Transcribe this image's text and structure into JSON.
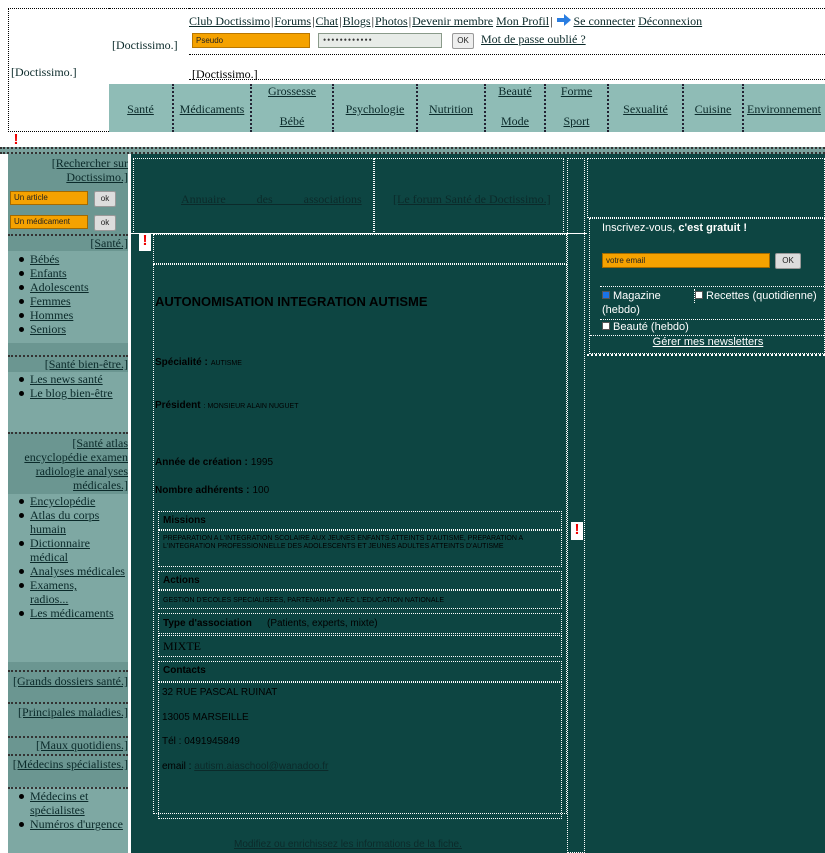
{
  "logo": {
    "main": "[Doctissimo.]",
    "secondary": "[Doctissimo.]",
    "banner": "[Doctissimo.]"
  },
  "topnav": {
    "links": [
      "Club Doctissimo",
      "Forums",
      "Chat",
      "Blogs",
      "Photos",
      "Devenir membre",
      "Mon Profil"
    ],
    "connect": "Se connecter",
    "disconnect": "Déconnexion"
  },
  "login": {
    "pseudo_value": "Pseudo",
    "password_value": "••••••••••••",
    "ok_label": "OK",
    "forgot": "Mot de passe oublié ?"
  },
  "mainnav": [
    {
      "label": "Santé"
    },
    {
      "label": "Médicaments"
    },
    {
      "top": "Grossesse",
      "bottom": "Bébé"
    },
    {
      "label": "Psychologie"
    },
    {
      "label": "Nutrition"
    },
    {
      "top": "Beauté",
      "bottom": "Mode"
    },
    {
      "top": "Forme",
      "bottom": "Sport"
    },
    {
      "label": "Sexualité"
    },
    {
      "label": "Cuisine"
    },
    {
      "label": "Environnement"
    }
  ],
  "sidebar": {
    "search_header": "[Rechercher sur Doctissimo.]",
    "search_article": "Un article",
    "search_medicament": "Un médicament",
    "ok_label": "ok",
    "sante_header": "[Santé.]",
    "sante_items": [
      "Bébés",
      "Enfants",
      "Adolescents",
      "Femmes",
      "Hommes",
      "Seniors"
    ],
    "bienetre_header": "[Santé bien-être.]",
    "bienetre_items": [
      "Les news santé",
      "Le blog bien-être"
    ],
    "atlas_header": "[Santé atlas encyclopédie examen radiologie analyses médicales.]",
    "atlas_items": [
      "Encyclopédie",
      "Atlas du corps humain",
      "Dictionnaire médical",
      "Analyses médicales",
      "Examens, radios...",
      "Les médicaments"
    ],
    "dossiers_header": "[Grands dossiers santé.]",
    "maladies_header": "[Principales maladies.]",
    "maux_header": "[Maux quotidiens.]",
    "medecins_header": "[Médecins spécialistes.]",
    "medecins_items": [
      "Médecins et spécialistes",
      "Numéros d'urgence"
    ]
  },
  "content": {
    "tab_annuaire": "Annuaire des associations",
    "tab_forum": "[Le forum Santé de Doctissimo.]",
    "title": "AUTONOMISATION INTEGRATION AUTISME",
    "specialite_label": "Spécialité :",
    "specialite_value": "AUTISME",
    "president_label": "Président",
    "president_value": ": MONSIEUR ALAIN NUGUET",
    "annee_label": "Année de création :",
    "annee_value": "1995",
    "adherents_label": "Nombre adhérents :",
    "adherents_value": "100",
    "missions_label": "Missions",
    "missions_value": "PREPARATION A L'INTEGRATION SCOLAIRE AUX JEUNES ENFANTS ATTEINTS D'AUTISME, PREPARATION A L'INTEGRATION PROFESSIONNELLE DES ADOLESCENTS ET JEUNES ADULTES ATTEINTS D'AUTISME",
    "actions_label": "Actions",
    "actions_value": "GESTION D'ECOLES SPECIALISEES, PARTENARIAT AVEC L'EDUCATION NATIONALE",
    "type_label": "Type d'association",
    "type_note": "(Patients, experts, mixte)",
    "type_value": "MIXTE",
    "contacts_label": "Contacts",
    "address1": "32 RUE PASCAL RUINAT",
    "address2": "13005 MARSEILLE",
    "tel": "Tél : 0491945849",
    "email_label": "email :",
    "email_value": "autism.aiaschool@wanadoo.fr",
    "modify_link": "Modifiez ou enrichissez les informations de la fiche."
  },
  "newsletter": {
    "prompt": "Inscrivez-vous,",
    "prompt_bold": "c'est gratuit !",
    "email_placeholder": "votre email",
    "ok_label": "OK",
    "magazine": "Magazine (hebdo)",
    "recettes": "Recettes (quotidienne)",
    "beaute": "Beauté (hebdo)",
    "manage": "Gérer mes newsletters"
  },
  "colors": {
    "teal_dark": "#0d4542",
    "teal_light": "#8fbcb6",
    "orange": "#f5a200",
    "warning": "#e00000"
  }
}
